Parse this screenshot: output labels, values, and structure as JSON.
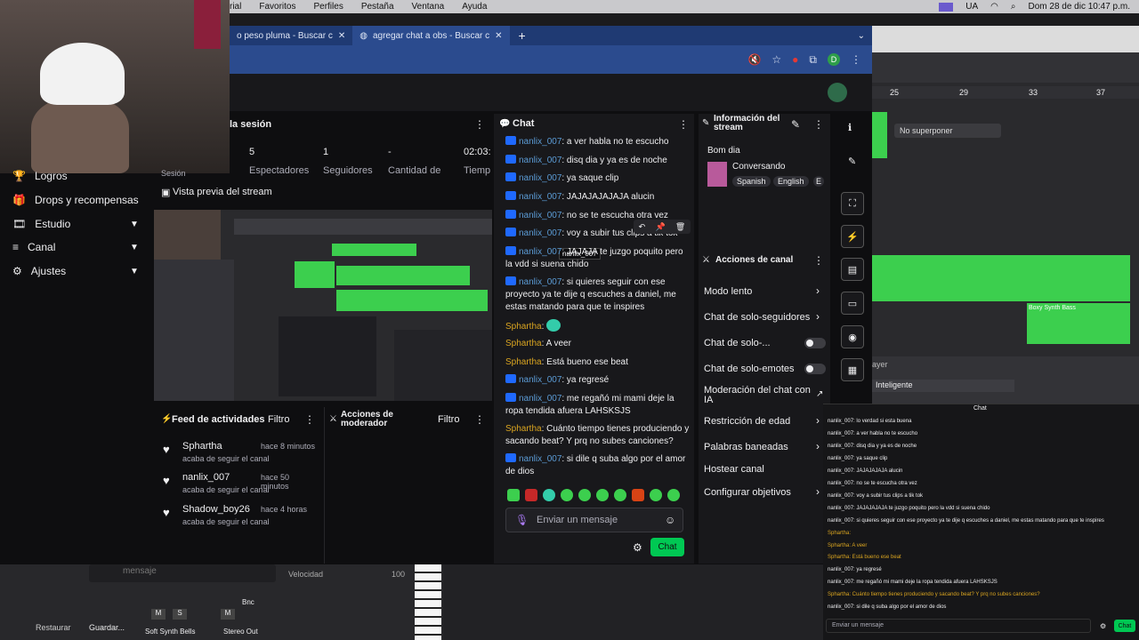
{
  "menubar": {
    "items": [
      "rial",
      "Favoritos",
      "Perfiles",
      "Pestaña",
      "Ventana",
      "Ayuda"
    ],
    "lang": "UA",
    "datetime": "Dom 28 de dic  10:47 p.m."
  },
  "browser": {
    "tabs": [
      {
        "label": "o peso pluma - Buscar c"
      },
      {
        "label": "agregar chat a obs - Buscar c"
      }
    ],
    "new_tab": "+",
    "profile": "D"
  },
  "session": {
    "title": "la sesión",
    "values": [
      "5",
      "1",
      "-",
      "02:03:"
    ],
    "labels": [
      "Espectadores",
      "Seguidores",
      "Cantidad de",
      "Tiemp"
    ],
    "sesion_label": "Sesión"
  },
  "nav": {
    "items": [
      {
        "label": "Logros"
      },
      {
        "label": "Drops y recompensas"
      },
      {
        "label": "Estudio"
      },
      {
        "label": "Canal"
      },
      {
        "label": "Ajustes"
      }
    ]
  },
  "preview": {
    "title": "Vista previa del stream"
  },
  "feed": {
    "title": "Feed de actividades",
    "filter": "Filtro",
    "items": [
      {
        "name": "Sphartha",
        "time": "hace 8 minutos",
        "sub": "acaba de seguir el canal"
      },
      {
        "name": "nanlix_007",
        "time": "hace 50 minutos",
        "sub": "acaba de seguir el canal"
      },
      {
        "name": "Shadow_boy26",
        "time": "hace 4 horas",
        "sub": "acaba de seguir el canal"
      }
    ]
  },
  "mod_actions": {
    "title": "Acciones de moderador",
    "filter": "Filtro"
  },
  "chat": {
    "title": "Chat",
    "tooltip": "nanlix_007",
    "messages": [
      {
        "user": "nanlix_007",
        "text": ": a ver habla no te escucho"
      },
      {
        "user": "nanlix_007",
        "text": ": disq dia y ya es de noche"
      },
      {
        "user": "nanlix_007",
        "text": ": ya saque clip"
      },
      {
        "user": "nanlix_007",
        "text": ": JAJAJAJAJAJA alucin"
      },
      {
        "user": "nanlix_007",
        "text": ": no se te escucha otra vez"
      },
      {
        "user": "nanlix_007",
        "text": ": voy a subir tus clips a tik tok"
      },
      {
        "user": "nanlix_007",
        "text": ": JAJAJA te juzgo poquito pero la vdd si suena chido"
      },
      {
        "user": "nanlix_007",
        "text": ": si quieres seguir con ese proyecto ya te dije q escuches a daniel, me estas matando para que te inspires"
      },
      {
        "user": "Sphartha",
        "text": ":"
      },
      {
        "user": "Sphartha",
        "text": ": A veer"
      },
      {
        "user": "Sphartha",
        "text": ": Está bueno ese beat"
      },
      {
        "user": "nanlix_007",
        "text": ": ya regresé"
      },
      {
        "user": "nanlix_007",
        "text": ": me regañó mi mami deje la ropa tendida afuera LAHSKSJS"
      },
      {
        "user": "Sphartha",
        "text": ": Cuánto tiempo tienes produciendo y sacando beat? Y prq no subes canciones?"
      },
      {
        "user": "nanlix_007",
        "text": ": si dile q suba algo por el amor de dios"
      }
    ],
    "input_placeholder": "Enviar un mensaje",
    "send_label": "Chat"
  },
  "stream_info": {
    "title": "Información del stream",
    "stream_title": "Bom dia",
    "category": "Conversando",
    "tags": [
      "Spanish",
      "English",
      "E"
    ]
  },
  "channel_actions": {
    "title": "Acciones de canal",
    "items": [
      {
        "label": "Modo lento",
        "kind": "chevron"
      },
      {
        "label": "Chat de solo-seguidores",
        "kind": "chevron"
      },
      {
        "label": "Chat de solo-...",
        "kind": "toggle"
      },
      {
        "label": "Chat de solo-emotes",
        "kind": "toggle"
      },
      {
        "label": "Moderación del chat con IA",
        "kind": "external"
      },
      {
        "label": "Restricción de edad",
        "kind": "chevron"
      },
      {
        "label": "Palabras baneadas",
        "kind": "chevron"
      },
      {
        "label": "Hostear canal",
        "kind": "chevron"
      },
      {
        "label": "Configurar objetivos",
        "kind": "chevron"
      }
    ]
  },
  "daw": {
    "superponer": "No superponer",
    "bars": [
      "25",
      "29",
      "33",
      "37"
    ],
    "region_label": "Boxy Synth Bass",
    "layer_label": "ayer",
    "preset": "Inteligente",
    "velocidad": "Velocidad",
    "velocidad_val": "100",
    "mensaje": "mensaje",
    "restaurar": "Restaurar",
    "guardar": "Guardar...",
    "bnc": "Bnc",
    "channels": [
      "Soft Synth Bells",
      "Stereo Out"
    ],
    "m": "M",
    "s": "S"
  },
  "dock": {
    "title": "Chat",
    "lines": [
      "nanlix_007: lo verdad si esta buena",
      "nanlix_007: a ver habla no te escucho",
      "nanlix_007: disq dia y ya es de noche",
      "nanlix_007: ya saque clip",
      "nanlix_007: JAJAJAJAJA alucin",
      "nanlix_007: no se te escucha otra vez",
      "nanlix_007: voy a subir tus clips a tik tok",
      "nanlix_007: JAJAJAJAJA te juzgo poquito pero la vdd si suena chido",
      "nanlix_007: si quieres seguir con ese proyecto ya te dije q escuches a daniel, me estas matando para que te inspires",
      "Sphartha:",
      "Sphartha: A veer",
      "Sphartha: Está bueno ese beat",
      "nanlix_007: ya regresé",
      "nanlix_007: me regañó mi mami deje la ropa tendida afuera LAHSKSJS",
      "Sphartha: Cuánto tiempo tienes produciendo y sacando beat? Y prq no subes canciones?",
      "nanlix_007: si dile q suba algo por el amor de dios"
    ],
    "input_placeholder": "Enviar un mensaje",
    "send_label": "Chat"
  },
  "colors": {
    "accent": "#9147ff",
    "send": "#00c853",
    "link_blue": "#5b9bd5",
    "gold": "#daa520",
    "daw_green": "#3ccf4e"
  }
}
